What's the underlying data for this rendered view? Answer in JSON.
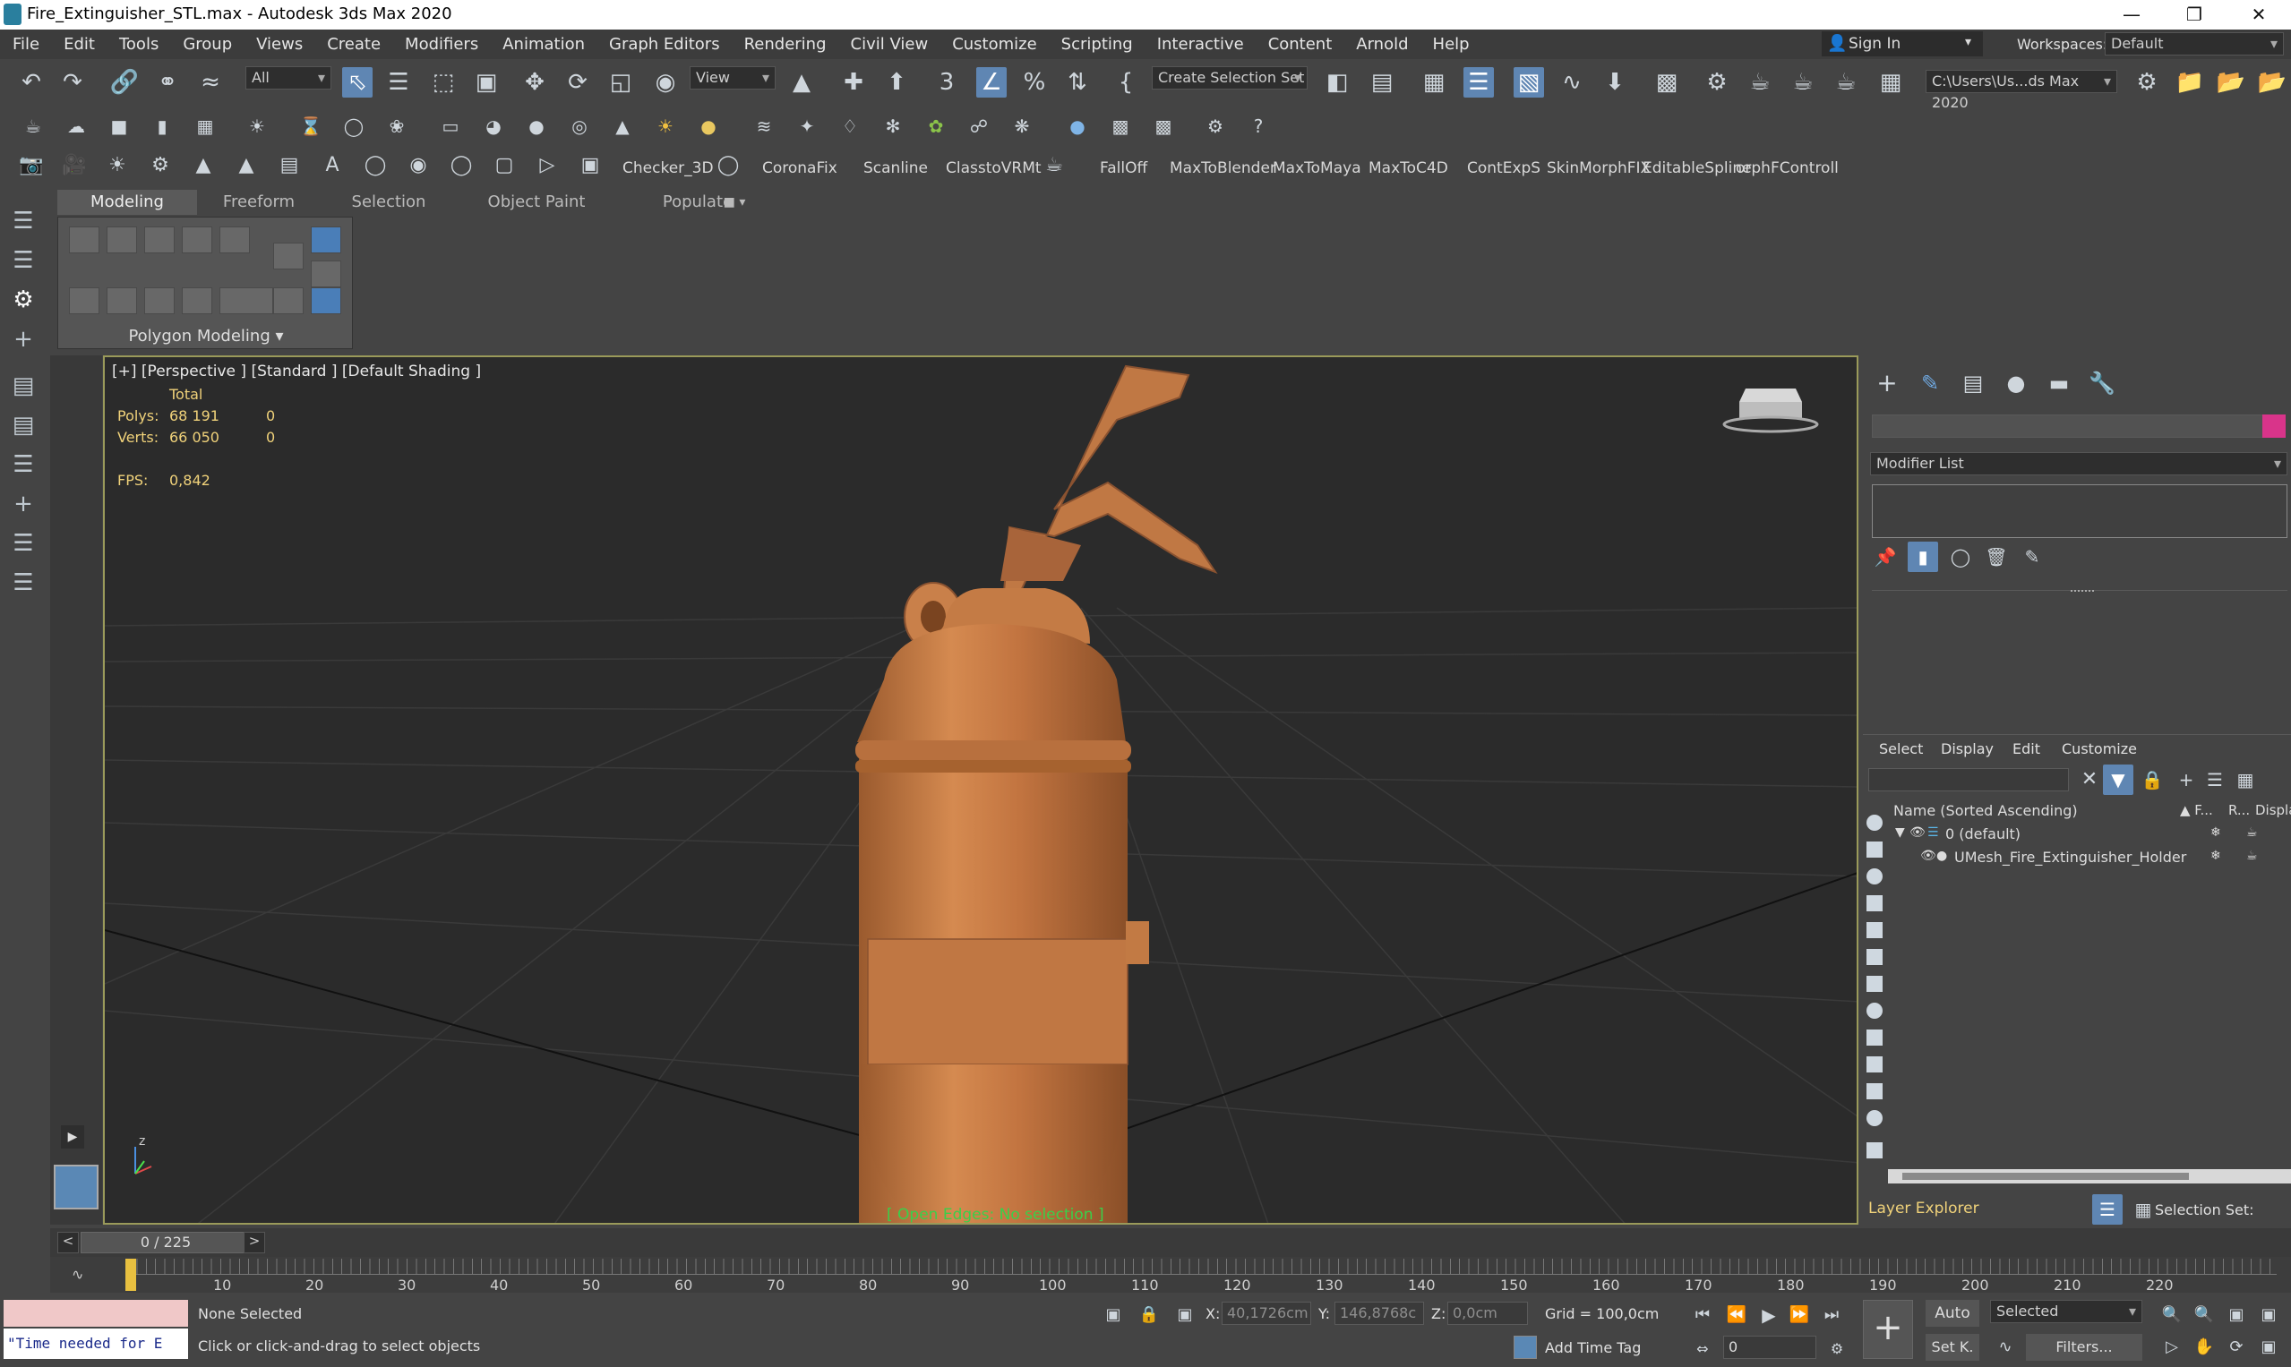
{
  "window": {
    "title": "Fire_Extinguisher_STL.max - Autodesk 3ds Max 2020"
  },
  "menu": [
    "File",
    "Edit",
    "Tools",
    "Group",
    "Views",
    "Create",
    "Modifiers",
    "Animation",
    "Graph Editors",
    "Rendering",
    "Civil View",
    "Customize",
    "Scripting",
    "Interactive",
    "Content",
    "Arnold",
    "Help"
  ],
  "account": {
    "sign_in": "Sign In",
    "workspaces_label": "Workspaces:",
    "workspace": "Default"
  },
  "toolbar": {
    "filter": "All",
    "ref_coord": "View",
    "selection_set": "Create Selection Set",
    "project_path": "C:\\Users\\Us...ds Max 2020"
  },
  "scripts": [
    "Checker_3D",
    "CoronaFix",
    "Scanline",
    "ClasstoVRMt",
    "FallOff",
    "MaxToBlender",
    "MaxToMaya",
    "MaxToC4D",
    "ContExpS",
    "SkinMorphFIX",
    "EditableSpline",
    "orphFControll"
  ],
  "ribbon": {
    "tabs": [
      "Modeling",
      "Freeform",
      "Selection",
      "Object Paint",
      "Populate"
    ],
    "panel_label": "Polygon Modeling"
  },
  "viewport": {
    "label": "[+] [Perspective ] [Standard ] [Default Shading ]",
    "stats": {
      "total_label": "Total",
      "polys_label": "Polys:",
      "polys": "68 191",
      "polys_sel": "0",
      "verts_label": "Verts:",
      "verts": "66 050",
      "verts_sel": "0",
      "fps_label": "FPS:",
      "fps": "0,842"
    },
    "edge_status": "[ Open Edges: No selection ]",
    "object_color": "#c97a45"
  },
  "command_panel": {
    "modifier_list": "Modifier List",
    "swatch_color": "#d9348a"
  },
  "scene_explorer": {
    "tabs": [
      "Select",
      "Display",
      "Edit",
      "Customize"
    ],
    "columns": {
      "name": "Name (Sorted Ascending)",
      "f": "▲ F...",
      "r": "R...",
      "d": "Displa"
    },
    "rows": [
      {
        "name": "0 (default)"
      },
      {
        "name": "UMesh_Fire_Extinguisher_Holder"
      }
    ],
    "footer": "Layer Explorer",
    "selection_set_label": "Selection Set:"
  },
  "timeline": {
    "frame": "0 / 225",
    "ticks": [
      "10",
      "20",
      "30",
      "40",
      "50",
      "60",
      "70",
      "80",
      "90",
      "100",
      "110",
      "120",
      "130",
      "140",
      "150",
      "160",
      "170",
      "180",
      "190",
      "200",
      "210",
      "220"
    ]
  },
  "status": {
    "maxscript": "\"Time needed for E",
    "selection": "None Selected",
    "prompt": "Click or click-and-drag to select objects",
    "x_label": "X:",
    "x": "40,1726cm",
    "y_label": "Y:",
    "y": "146,8768c",
    "z_label": "Z:",
    "z": "0,0cm",
    "grid": "Grid = 100,0cm",
    "add_time_tag": "Add Time Tag",
    "auto": "Auto",
    "selected": "Selected",
    "setk": "Set K.",
    "filters": "Filters...",
    "frame_field": "0"
  }
}
